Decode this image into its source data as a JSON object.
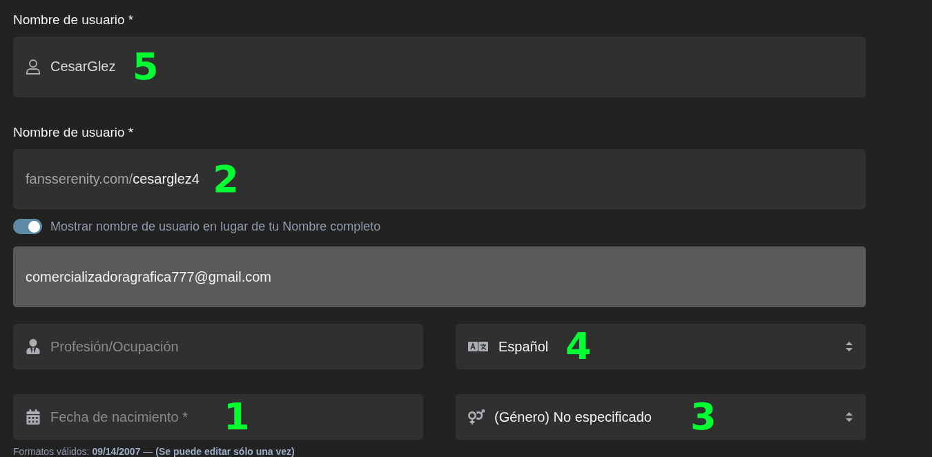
{
  "display_name": {
    "label": "Nombre de usuario *",
    "value": "CesarGlez",
    "annotation": "5"
  },
  "username": {
    "label": "Nombre de usuario *",
    "prefix": "fansserenity.com/",
    "value": "cesarglez4",
    "annotation": "2"
  },
  "show_username_toggle": {
    "on": true,
    "label": "Mostrar nombre de usuario en lugar de tu Nombre completo"
  },
  "email": {
    "value": "comercializadoragrafica777@gmail.com",
    "disabled": true
  },
  "profession": {
    "placeholder": "Profesión/Ocupación"
  },
  "language": {
    "value": "Español",
    "annotation": "4"
  },
  "birthdate": {
    "placeholder": "Fecha de nacimiento *",
    "annotation": "1"
  },
  "gender": {
    "value": "(Género) No especificado",
    "annotation": "3"
  },
  "hint": "Formatos válidos: **09/14/2007** — **(Se puede editar sólo una vez)**"
}
